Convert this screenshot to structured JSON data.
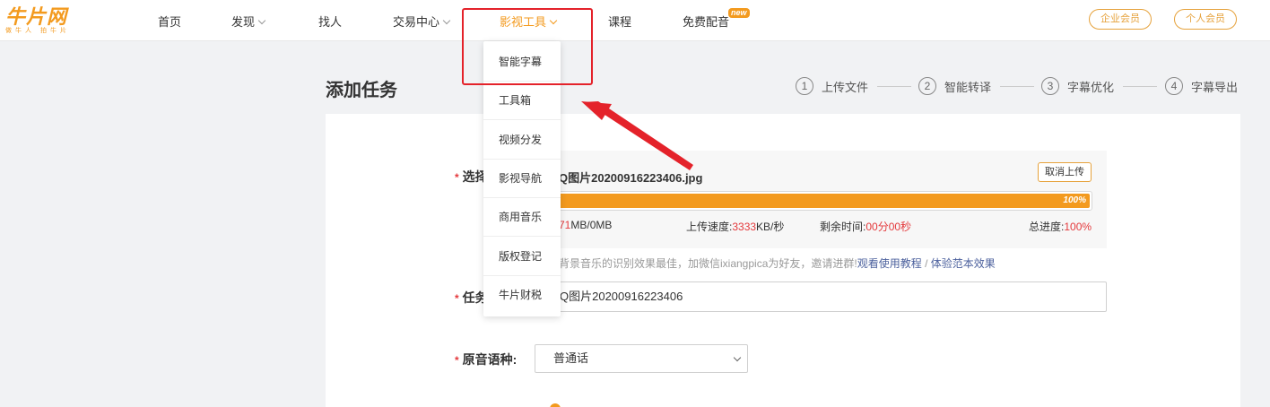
{
  "logo": {
    "main": "牛片网",
    "sub": "做牛人 拍牛片"
  },
  "nav": [
    {
      "label": "首页",
      "has_chevron": false,
      "active": false
    },
    {
      "label": "发现",
      "has_chevron": true,
      "active": false
    },
    {
      "label": "找人",
      "has_chevron": false,
      "active": false
    },
    {
      "label": "交易中心",
      "has_chevron": true,
      "active": false
    },
    {
      "label": "影视工具",
      "has_chevron": true,
      "active": true
    },
    {
      "label": "课程",
      "has_chevron": false,
      "active": false
    },
    {
      "label": "免费配音",
      "has_chevron": false,
      "active": false,
      "badge": "new"
    }
  ],
  "header_buttons": {
    "enterprise": "企业会员",
    "personal": "个人会员"
  },
  "dropdown": {
    "items": [
      "智能字幕",
      "工具箱",
      "视频分发",
      "影视导航",
      "商用音乐",
      "版权登记",
      "牛片财税"
    ]
  },
  "page": {
    "title": "添加任务"
  },
  "steps": [
    {
      "num": "1",
      "label": "上传文件"
    },
    {
      "num": "2",
      "label": "智能转译"
    },
    {
      "num": "3",
      "label": "字幕优化"
    },
    {
      "num": "4",
      "label": "字幕导出"
    }
  ],
  "form": {
    "select_label": "选择",
    "task_label": "任务",
    "lang_label": "原音语种:",
    "file_name": "QQ图片20200916223406.jpg",
    "file_name_visible": "Q图片20200916223406.jpg",
    "cancel_upload": "取消上传",
    "progress_percent": 100,
    "progress_text": "100%",
    "size_value": "71",
    "size_rest": "MB/0MB",
    "speed_label": "上传速度:",
    "speed_value": "3333",
    "speed_unit": "KB/秒",
    "remain_label": "剩余时间:",
    "remain_value": "00分00秒",
    "total_label": "总进度:",
    "total_value": "100%",
    "hint_text": "背景音乐的识别效果最佳，加微信ixiangpica为好友，邀请进群!",
    "hint_link1": "观看使用教程",
    "hint_sep": " / ",
    "hint_link2": "体验范本效果",
    "task_name_value": "Q图片20200916223406",
    "language_value": "普通话"
  },
  "colors": {
    "accent": "#f39a1e",
    "annotation": "#e4222a",
    "error": "#e4393c"
  }
}
